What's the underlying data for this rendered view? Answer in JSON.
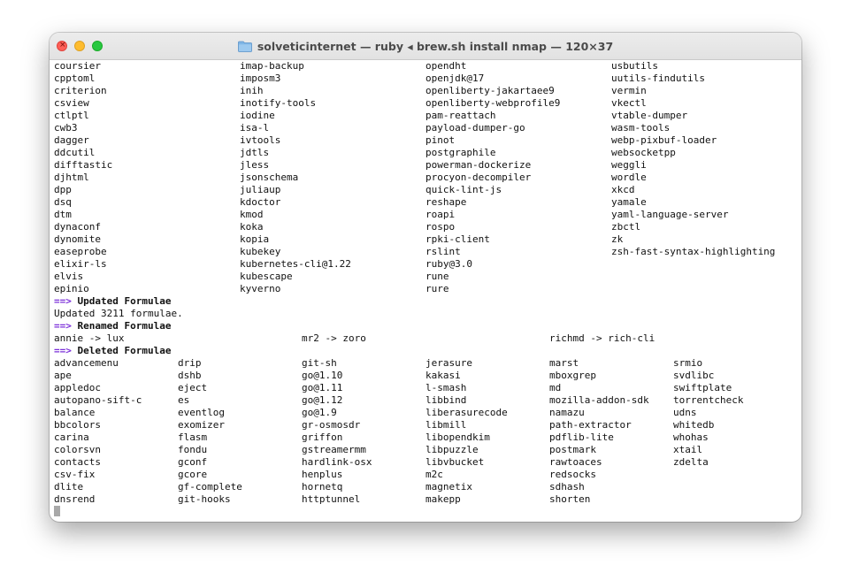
{
  "window": {
    "title": "solveticinternet — ruby ◂ brew.sh install nmap — 120×37"
  },
  "terminal": {
    "block1_columns": [
      [
        "coursier",
        "cpptoml",
        "criterion",
        "csview",
        "ctlptl",
        "cwb3",
        "dagger",
        "ddcutil",
        "difftastic",
        "djhtml",
        "dpp",
        "dsq",
        "dtm",
        "dynaconf",
        "dynomite",
        "easeprobe",
        "elixir-ls",
        "elvis",
        "epinio"
      ],
      [
        "imap-backup",
        "imposm3",
        "inih",
        "inotify-tools",
        "iodine",
        "isa-l",
        "ivtools",
        "jdtls",
        "jless",
        "jsonschema",
        "juliaup",
        "kdoctor",
        "kmod",
        "koka",
        "kopia",
        "kubekey",
        "kubernetes-cli@1.22",
        "kubescape",
        "kyverno"
      ],
      [
        "opendht",
        "openjdk@17",
        "openliberty-jakartaee9",
        "openliberty-webprofile9",
        "pam-reattach",
        "payload-dumper-go",
        "pinot",
        "postgraphile",
        "powerman-dockerize",
        "procyon-decompiler",
        "quick-lint-js",
        "reshape",
        "roapi",
        "rospo",
        "rpki-client",
        "rslint",
        "ruby@3.0",
        "rune",
        "rure"
      ],
      [
        "usbutils",
        "uutils-findutils",
        "vermin",
        "vkectl",
        "vtable-dumper",
        "wasm-tools",
        "webp-pixbuf-loader",
        "websocketpp",
        "weggli",
        "wordle",
        "xkcd",
        "yamale",
        "yaml-language-server",
        "zbctl",
        "zk",
        "zsh-fast-syntax-highlighting"
      ]
    ],
    "arrow": "==>",
    "updated_header": "Updated Formulae",
    "updated_text": "Updated 3211 formulae.",
    "renamed_header": "Renamed Formulae",
    "renamed": [
      "annie -> lux",
      "mr2 -> zoro",
      "richmd -> rich-cli"
    ],
    "deleted_header": "Deleted Formulae",
    "deleted_columns": [
      [
        "advancemenu",
        "ape",
        "appledoc",
        "autopano-sift-c",
        "balance",
        "bbcolors",
        "carina",
        "colorsvn",
        "contacts",
        "csv-fix",
        "dlite",
        "dnsrend"
      ],
      [
        "drip",
        "dshb",
        "eject",
        "es",
        "eventlog",
        "exomizer",
        "flasm",
        "fondu",
        "gconf",
        "gcore",
        "gf-complete",
        "git-hooks"
      ],
      [
        "git-sh",
        "go@1.10",
        "go@1.11",
        "go@1.12",
        "go@1.9",
        "gr-osmosdr",
        "griffon",
        "gstreamermm",
        "hardlink-osx",
        "henplus",
        "hornetq",
        "httptunnel"
      ],
      [
        "jerasure",
        "kakasi",
        "l-smash",
        "libbind",
        "liberasurecode",
        "libmill",
        "libopendkim",
        "libpuzzle",
        "libvbucket",
        "m2c",
        "magnetix",
        "makepp"
      ],
      [
        "marst",
        "mboxgrep",
        "md",
        "mozilla-addon-sdk",
        "namazu",
        "path-extractor",
        "pdflib-lite",
        "postmark",
        "rawtoaces",
        "redsocks",
        "sdhash",
        "shorten"
      ],
      [
        "srmio",
        "svdlibc",
        "swiftplate",
        "torrentcheck",
        "udns",
        "whitedb",
        "whohas",
        "xtail",
        "zdelta"
      ]
    ]
  },
  "colors": {
    "arrow": "#7b2fd9",
    "close": "#fe5f57",
    "minimize": "#febc2e",
    "maximize": "#28c840",
    "logo_ring": "#b9d7e6"
  },
  "icons": [
    "folder-icon",
    "close-icon",
    "minimize-icon",
    "maximize-icon",
    "question-logo-icon"
  ]
}
